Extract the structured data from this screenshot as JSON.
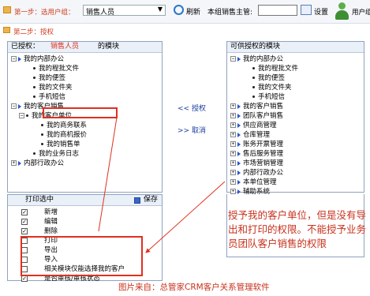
{
  "step1": {
    "label": "第一步：选用户组：",
    "group_value": "销售人员",
    "refresh": "刷新",
    "supervisor_label": "本组销售主管:",
    "supervisor_value": "",
    "settings": "设置",
    "users": "用户组"
  },
  "step2": {
    "label": "第二步：授权"
  },
  "left_panel": {
    "header_prefix": "已授权：",
    "header_role": "销售人员",
    "header_suffix": "的模块",
    "tree": [
      {
        "label": "我的内部办公"
      },
      {
        "label": "我的程批文件"
      },
      {
        "label": "我的便签"
      },
      {
        "label": "我的文件夹"
      },
      {
        "label": "手机短信"
      },
      {
        "label": "我的客户销售"
      },
      {
        "label": "我的客户单位"
      },
      {
        "label": "我的商务联系"
      },
      {
        "label": "我的商机报价"
      },
      {
        "label": "我的销售单"
      },
      {
        "label": "我的业务日志"
      },
      {
        "label": "内部行政办公"
      }
    ]
  },
  "perm_panel": {
    "print_selected": "打印选中",
    "save": "保存",
    "items": [
      {
        "label": "新增",
        "checked": true
      },
      {
        "label": "编辑",
        "checked": true
      },
      {
        "label": "删除",
        "checked": true
      },
      {
        "label": "打印",
        "checked": false
      },
      {
        "label": "导出",
        "checked": false
      },
      {
        "label": "导入",
        "checked": false
      },
      {
        "label": "相关模块仅能选择我的客户",
        "checked": false
      },
      {
        "label": "是否审核/审核状态",
        "checked": true
      }
    ]
  },
  "middle": {
    "grant": "授权",
    "revoke": "取消",
    "grant_arrows": "<<",
    "revoke_arrows": ">>"
  },
  "right_panel": {
    "header": "可供授权的模块",
    "tree": [
      {
        "label": "我的内部办公"
      },
      {
        "label": "我的程批文件"
      },
      {
        "label": "我的便签"
      },
      {
        "label": "我的文件夹"
      },
      {
        "label": "手机短信"
      },
      {
        "label": "我的客户销售"
      },
      {
        "label": "团队客户销售"
      },
      {
        "label": "供应商管理"
      },
      {
        "label": "仓库管理"
      },
      {
        "label": "账务开票管理"
      },
      {
        "label": "售后服务管理"
      },
      {
        "label": "市场营销管理"
      },
      {
        "label": "内部行政办公"
      },
      {
        "label": "本单位管理"
      },
      {
        "label": "辅助系统"
      }
    ]
  },
  "annotation": {
    "text": "授予我的客户单位，但是没有导出和打印的权限。不能授予业务员团队客户销售的权限",
    "source": "图片来自：总管家CRM客户关系管理软件"
  },
  "colors": {
    "accent_red": "#e03020",
    "bullet_blue": "#2a58c8",
    "panel_border": "#8fa3bf"
  }
}
